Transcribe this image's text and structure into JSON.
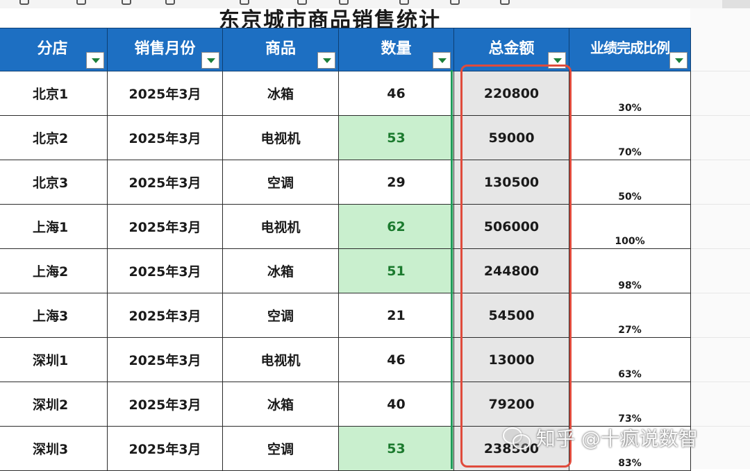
{
  "sheet": {
    "title": "东京城市商品销售统计"
  },
  "table": {
    "headers": [
      "分店",
      "销售月份",
      "商品",
      "数量",
      "总金额",
      "业绩完成比例"
    ],
    "rows": [
      {
        "store": "北京1",
        "month": "2025年3月",
        "product": "冰箱",
        "qty": "46",
        "qty_highlight": false,
        "total": "220800",
        "pct": "30%"
      },
      {
        "store": "北京2",
        "month": "2025年3月",
        "product": "电视机",
        "qty": "53",
        "qty_highlight": true,
        "total": "59000",
        "pct": "70%"
      },
      {
        "store": "北京3",
        "month": "2025年3月",
        "product": "空调",
        "qty": "29",
        "qty_highlight": false,
        "total": "130500",
        "pct": "50%"
      },
      {
        "store": "上海1",
        "month": "2025年3月",
        "product": "电视机",
        "qty": "62",
        "qty_highlight": true,
        "total": "506000",
        "pct": "100%"
      },
      {
        "store": "上海2",
        "month": "2025年3月",
        "product": "冰箱",
        "qty": "51",
        "qty_highlight": true,
        "total": "244800",
        "pct": "98%"
      },
      {
        "store": "上海3",
        "month": "2025年3月",
        "product": "空调",
        "qty": "21",
        "qty_highlight": false,
        "total": "54500",
        "pct": "27%"
      },
      {
        "store": "深圳1",
        "month": "2025年3月",
        "product": "电视机",
        "qty": "46",
        "qty_highlight": false,
        "total": "13000",
        "pct": "63%"
      },
      {
        "store": "深圳2",
        "month": "2025年3月",
        "product": "冰箱",
        "qty": "40",
        "qty_highlight": false,
        "total": "79200",
        "pct": "73%"
      },
      {
        "store": "深圳3",
        "month": "2025年3月",
        "product": "空调",
        "qty": "53",
        "qty_highlight": true,
        "total": "238500",
        "pct": "83%"
      }
    ]
  },
  "watermark": {
    "text": "知乎 @十疯说数智"
  },
  "colors": {
    "header_bg": "#1d6fc2",
    "qty_highlight_bg": "#c9efce",
    "qty_highlight_text": "#1b7a2e",
    "total_bg": "#e6e6e6",
    "highlight_box": "#e04b3c",
    "filter_arrow": "#1b7f3a"
  }
}
